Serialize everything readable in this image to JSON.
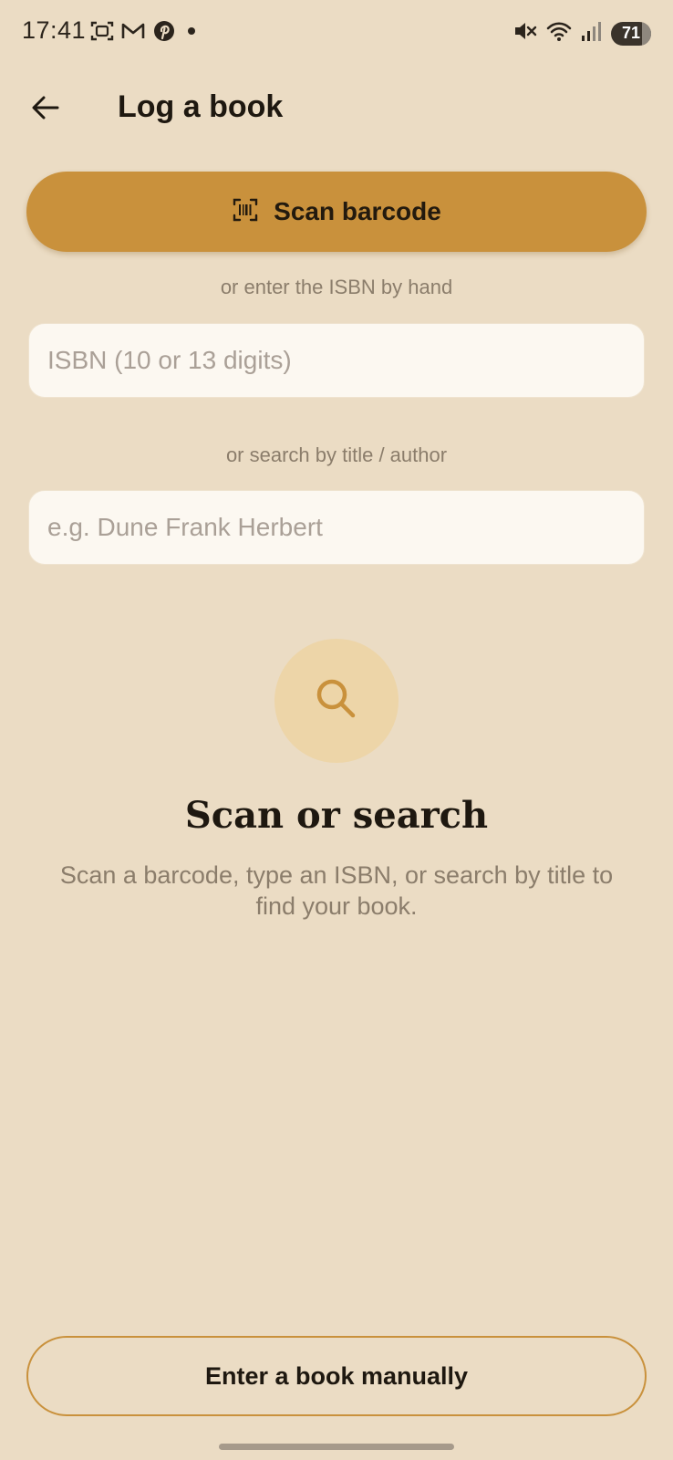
{
  "status_bar": {
    "time": "17:41",
    "left_icons": [
      "screenshot-icon",
      "gmail-icon",
      "pinterest-icon",
      "dot-icon"
    ],
    "right_icons": [
      "mute-icon",
      "wifi-icon",
      "signal-icon"
    ],
    "battery_level": "71"
  },
  "header": {
    "title": "Log a book",
    "back_icon": "arrow-left-icon"
  },
  "scan": {
    "label": "Scan barcode",
    "icon": "barcode-scan-icon"
  },
  "isbn": {
    "helper": "or enter the ISBN by hand",
    "placeholder": "ISBN (10 or 13 digits)",
    "value": ""
  },
  "search": {
    "helper": "or search by title / author",
    "placeholder": "e.g. Dune Frank Herbert",
    "value": ""
  },
  "empty_state": {
    "icon": "search-icon",
    "title": "Scan or search",
    "description": "Scan a barcode, type an ISBN, or search by title to find your book."
  },
  "manual": {
    "label": "Enter a book manually"
  },
  "colors": {
    "background": "#ebdcc4",
    "accent": "#c9913c",
    "input_bg": "#fcf8f1",
    "icon_circle": "#edd5a8",
    "muted_text": "#8b7d6b"
  }
}
